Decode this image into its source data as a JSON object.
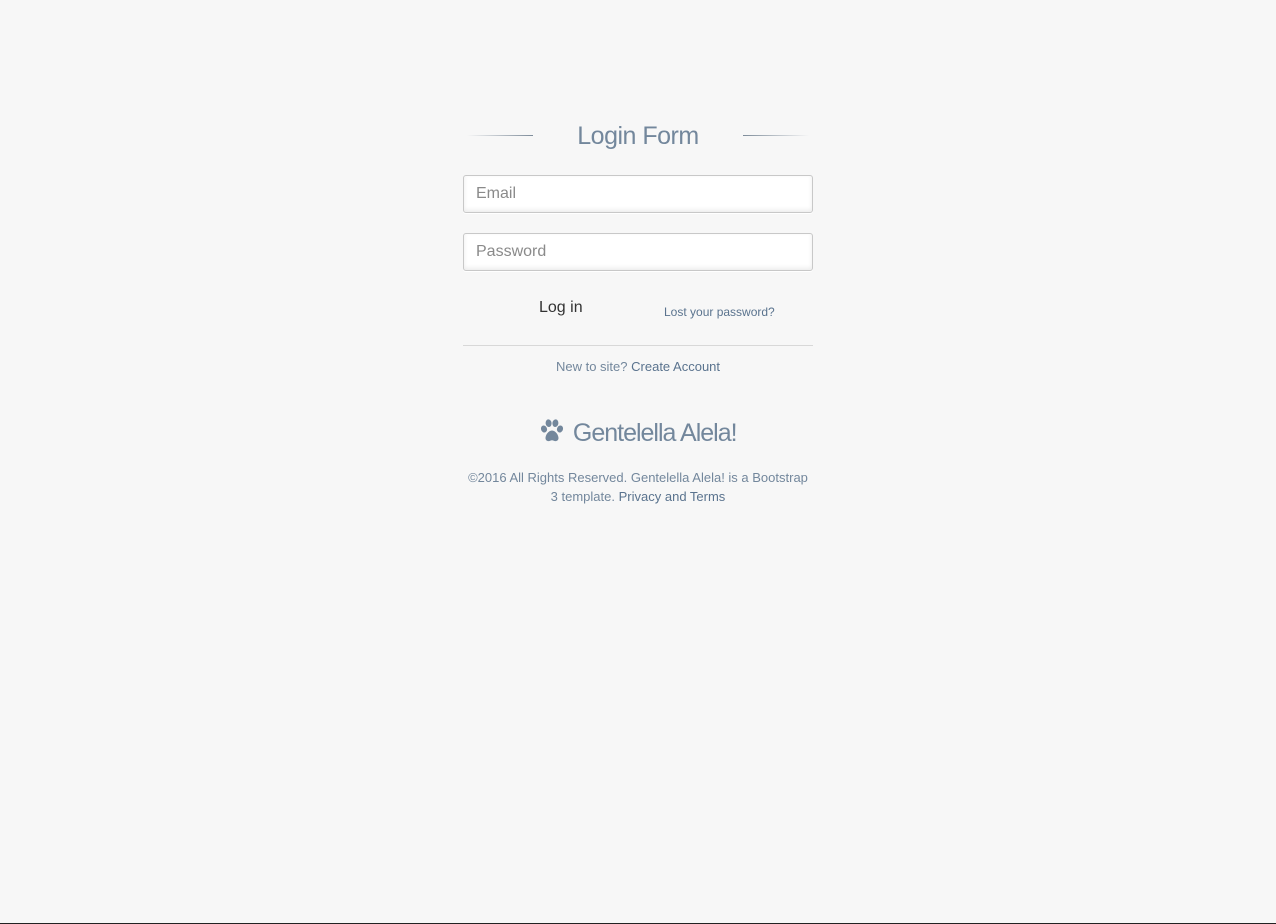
{
  "login_form": {
    "title": "Login Form",
    "email": {
      "placeholder": "Email",
      "value": ""
    },
    "password": {
      "placeholder": "Password",
      "value": ""
    },
    "login_button_label": "Log in",
    "lost_password_link": "Lost your password?",
    "signup_prompt": "New to site?",
    "create_account_link": "Create Account"
  },
  "brand": {
    "icon": "paw-icon",
    "name": "Gentelella Alela!"
  },
  "footer": {
    "copyright_text": "©2016 All Rights Reserved. Gentelella Alela! is a Bootstrap 3 template.",
    "privacy_link": "Privacy and Terms"
  },
  "colors": {
    "background": "#f7f7f7",
    "text": "#73879c",
    "link": "#5a738e",
    "button_text": "#333333"
  }
}
